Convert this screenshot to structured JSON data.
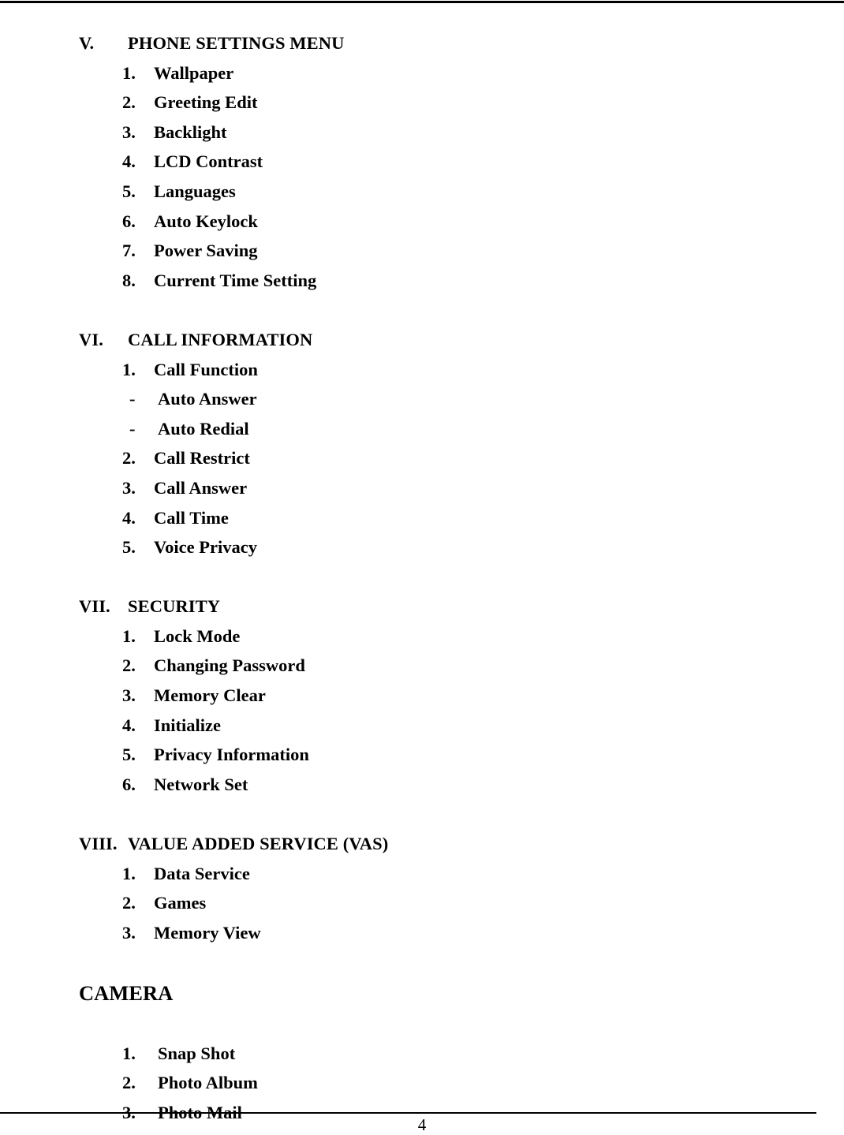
{
  "document": {
    "page_number": "4",
    "sections": [
      {
        "numeral": "V.",
        "title": "PHONE SETTINGS MENU",
        "items": [
          {
            "num": "1.",
            "label": "Wallpaper"
          },
          {
            "num": "2.",
            "label": "Greeting Edit"
          },
          {
            "num": "3.",
            "label": "Backlight"
          },
          {
            "num": "4.",
            "label": "LCD Contrast"
          },
          {
            "num": "5.",
            "label": "Languages"
          },
          {
            "num": "6.",
            "label": "Auto Keylock"
          },
          {
            "num": "7.",
            "label": "Power Saving"
          },
          {
            "num": "8.",
            "label": "Current Time Setting"
          }
        ]
      },
      {
        "numeral": "VI.",
        "title": "CALL INFORMATION",
        "items": [
          {
            "num": "1.",
            "label": "Call Function"
          },
          {
            "dash": "-",
            "label": "Auto Answer"
          },
          {
            "dash": "-",
            "label": "Auto Redial"
          },
          {
            "num": "2.",
            "label": "Call Restrict"
          },
          {
            "num": "3.",
            "label": "Call Answer"
          },
          {
            "num": "4.",
            "label": "Call Time"
          },
          {
            "num": "5.",
            "label": "Voice Privacy"
          }
        ]
      },
      {
        "numeral": "VII.",
        "title": "SECURITY",
        "items": [
          {
            "num": "1.",
            "label": "Lock Mode"
          },
          {
            "num": "2.",
            "label": "Changing Password"
          },
          {
            "num": "3.",
            "label": "Memory Clear"
          },
          {
            "num": "4.",
            "label": "Initialize"
          },
          {
            "num": "5.",
            "label": "Privacy Information"
          },
          {
            "num": "6.",
            "label": "Network Set"
          }
        ]
      },
      {
        "numeral": "VIII.",
        "title": "VALUE ADDED SERVICE (VAS)",
        "items": [
          {
            "num": "1.",
            "label": "Data Service"
          },
          {
            "num": "2.",
            "label": "Games"
          },
          {
            "num": "3.",
            "label": "Memory View"
          }
        ]
      }
    ],
    "camera_section": {
      "title": "CAMERA",
      "items": [
        {
          "num": "1.",
          "label": "Snap Shot"
        },
        {
          "num": "2.",
          "label": "Photo Album"
        },
        {
          "num": "3.",
          "label": "Photo Mail"
        }
      ]
    }
  }
}
